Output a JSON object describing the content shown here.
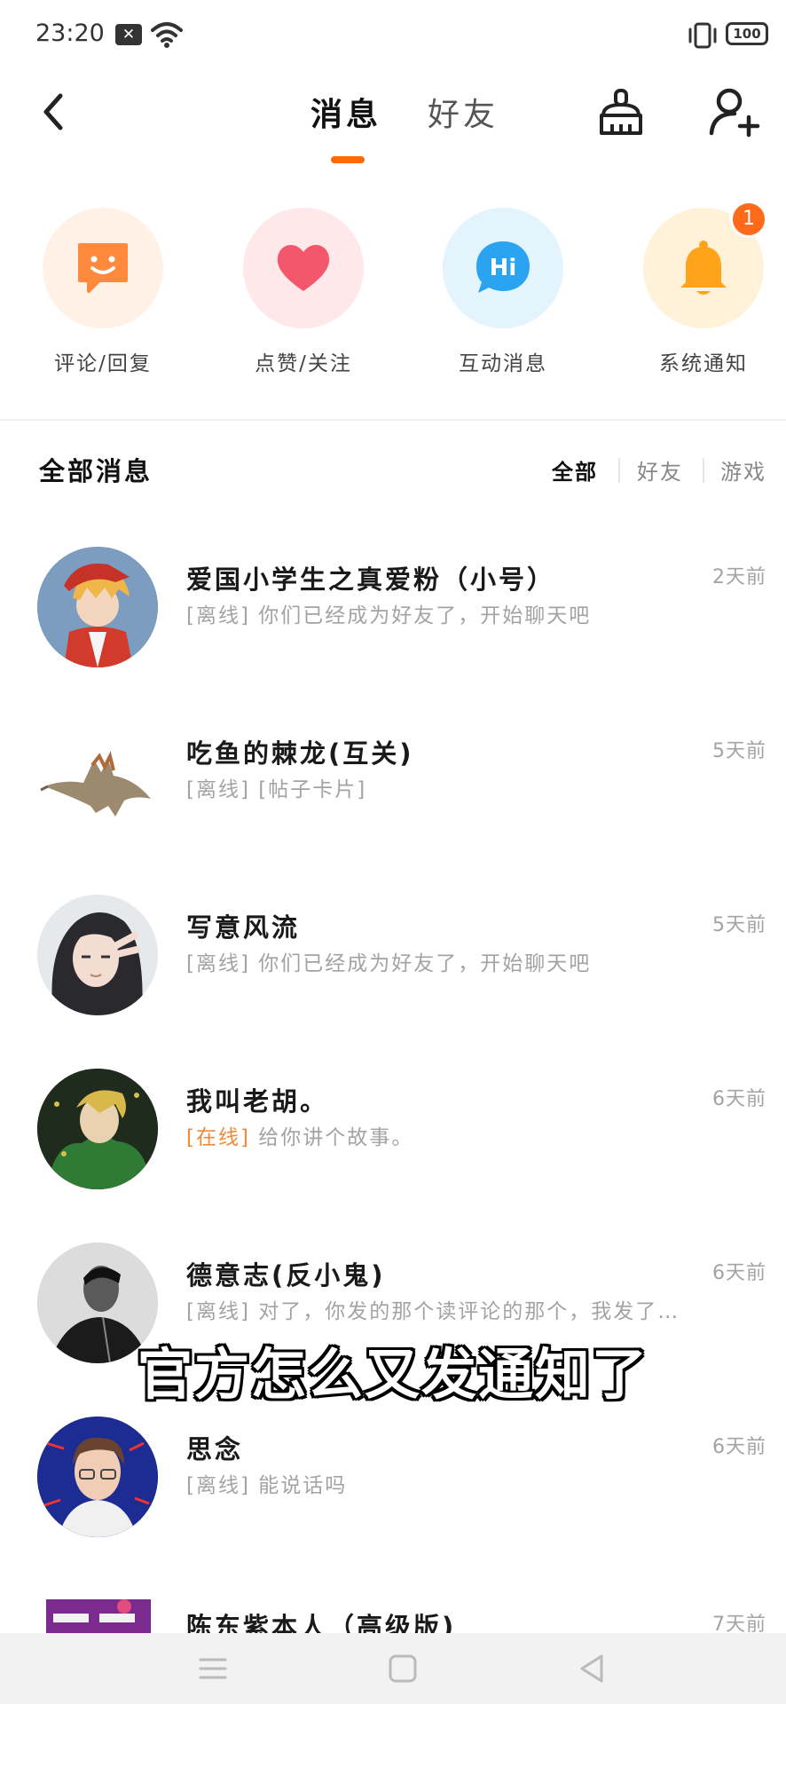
{
  "status_bar": {
    "time": "23:20",
    "battery": "100"
  },
  "header": {
    "tabs": [
      {
        "label": "消息"
      },
      {
        "label": "好友"
      }
    ]
  },
  "quick_entries": [
    {
      "label": "评论/回复",
      "icon": "smile-chat-icon",
      "color": "#ff8a3d"
    },
    {
      "label": "点赞/关注",
      "icon": "heart-icon",
      "color": "#f2576b"
    },
    {
      "label": "互动消息",
      "icon": "hi-chat-icon",
      "color": "#2aa3f0"
    },
    {
      "label": "系统通知",
      "icon": "bell-icon",
      "color": "#ffa31a",
      "badge": "1"
    }
  ],
  "section": {
    "title": "全部消息",
    "filters": [
      "全部",
      "好友",
      "游戏"
    ]
  },
  "conversations": [
    {
      "name": "爱国小学生之真爱粉（小号）",
      "status": "[离线]",
      "message": "你们已经成为好友了，开始聊天吧",
      "time": "2天前",
      "online": false
    },
    {
      "name": "吃鱼的棘龙(互关)",
      "status": "[离线]",
      "message": "[帖子卡片]",
      "time": "5天前",
      "online": false
    },
    {
      "name": "写意风流",
      "status": "[离线]",
      "message": "你们已经成为好友了，开始聊天吧",
      "time": "5天前",
      "online": false
    },
    {
      "name": "我叫老胡。",
      "status": "[在线]",
      "message": "给你讲个故事。",
      "time": "6天前",
      "online": true
    },
    {
      "name": "德意志(反小鬼)",
      "status": "[离线]",
      "message": "对了，你发的那个读评论的那个，我发了…",
      "time": "6天前",
      "online": false
    },
    {
      "name": "思念",
      "status": "[离线]",
      "message": "能说话吗",
      "time": "6天前",
      "online": false
    },
    {
      "name": "陈东紫本人（高级版)",
      "status": "",
      "message": "",
      "time": "7天前",
      "online": false
    }
  ],
  "caption": "官方怎么又发通知了",
  "colors": {
    "accent": "#ff6a00",
    "online": "#f08a3a"
  }
}
